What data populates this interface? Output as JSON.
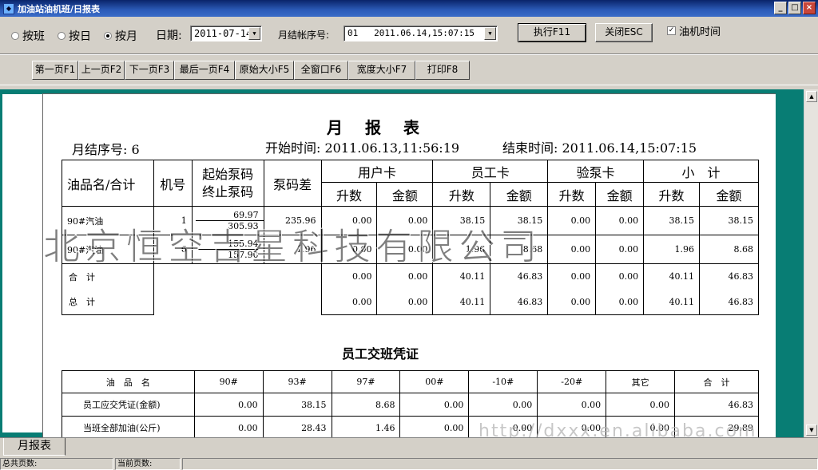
{
  "window": {
    "title": "加油站油机班/日报表",
    "minimize": "_",
    "maximize": "□",
    "close": "×"
  },
  "controls": {
    "radio_shift": "按班",
    "radio_day": "按日",
    "radio_month": "按月",
    "date_label": "日期:",
    "date_value": "2011-07-14",
    "period_label": "月结帐序号:",
    "period_value": "01   2011.06.14,15:07:15",
    "execute_label": "执行F11",
    "close_label": "关闭ESC",
    "checkbox_label": "油机时间",
    "checkbox_mark": "✓"
  },
  "toolbar": {
    "first": "第一页F1",
    "prev": "上一页F2",
    "next": "下一页F3",
    "last": "最后一页F4",
    "original": "原始大小F5",
    "fullwin": "全窗口F6",
    "width": "宽度大小F7",
    "print": "打印F8"
  },
  "report": {
    "title": "月报表",
    "seq_label": "月结序号:",
    "seq_value": "6",
    "start_label": "开始时间:",
    "start_value": "2011.06.13,11:56:19",
    "end_label": "结束时间:",
    "end_value": "2011.06.14,15:07:15",
    "headers": {
      "product": "油品名/合计",
      "machine": "机号",
      "pump_start": "起始泵码",
      "pump_end": "终止泵码",
      "diff": "泵码差",
      "user_card": "用户卡",
      "staff_card": "员工卡",
      "test_card": "验泵卡",
      "subtotal": "小　计",
      "liters": "升数",
      "amount": "金额"
    },
    "rows": [
      {
        "product": "90#汽油",
        "machine": "1",
        "pump_start": "69.97",
        "pump_end": "305.93",
        "diff": "235.96",
        "uc_l": "0.00",
        "uc_a": "0.00",
        "sc_l": "38.15",
        "sc_a": "38.15",
        "tc_l": "0.00",
        "tc_a": "0.00",
        "st_l": "38.15",
        "st_a": "38.15"
      },
      {
        "product": "90#汽油",
        "machine": "6",
        "pump_start": "155.94",
        "pump_end": "157.90",
        "diff": "1.96",
        "uc_l": "0.00",
        "uc_a": "0.00",
        "sc_l": "1.96",
        "sc_a": "8.68",
        "tc_l": "0.00",
        "tc_a": "0.00",
        "st_l": "1.96",
        "st_a": "8.68"
      }
    ],
    "sum_label": "合　计",
    "total_label": "总　计",
    "sum_row": {
      "uc_l": "0.00",
      "uc_a": "0.00",
      "sc_l": "40.11",
      "sc_a": "46.83",
      "tc_l": "0.00",
      "tc_a": "0.00",
      "st_l": "40.11",
      "st_a": "46.83"
    },
    "total_row": {
      "uc_l": "0.00",
      "uc_a": "0.00",
      "sc_l": "40.11",
      "sc_a": "46.83",
      "tc_l": "0.00",
      "tc_a": "0.00",
      "st_l": "40.11",
      "st_a": "46.83"
    }
  },
  "voucher": {
    "title": "员工交班凭证",
    "headers": [
      "油　品　名",
      "90#",
      "93#",
      "97#",
      "00#",
      "-10#",
      "-20#",
      "其它",
      "合　计"
    ],
    "rows": [
      {
        "label": "员工应交凭证(金额)",
        "values": [
          "0.00",
          "38.15",
          "8.68",
          "0.00",
          "0.00",
          "0.00",
          "0.00",
          "46.83"
        ]
      },
      {
        "label": "当班全部加油(公斤)",
        "values": [
          "0.00",
          "28.43",
          "1.46",
          "0.00",
          "0.00",
          "0.00",
          "0.00",
          "29.89"
        ]
      }
    ]
  },
  "watermark": "北京恒空吉星科技有限公司",
  "watermark_url": "http://dxxx.en.alibaba.com",
  "tabs": {
    "monthly": "月报表"
  },
  "status": {
    "total_pages": "总共页数:",
    "current_page": "当前页数:"
  }
}
